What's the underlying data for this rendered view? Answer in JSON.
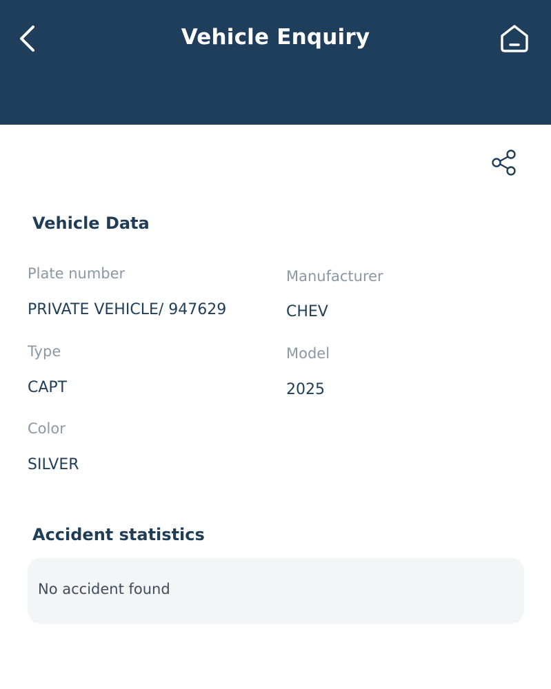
{
  "header": {
    "title": "Vehicle Enquiry",
    "back_icon": "chevron-left-icon",
    "home_icon": "home-icon",
    "background_color": "#1f3e5b"
  },
  "share_icon": "share-icon",
  "vehicle_data": {
    "title": "Vehicle Data",
    "plate_number": {
      "label": "Plate number",
      "value": "PRIVATE VEHICLE/ 947629"
    },
    "manufacturer": {
      "label": "Manufacturer",
      "value": "CHEV"
    },
    "type": {
      "label": "Type",
      "value": "CAPT"
    },
    "model": {
      "label": "Model",
      "value": "2025"
    },
    "color": {
      "label": "Color",
      "value": "SILVER"
    }
  },
  "accident_statistics": {
    "title": "Accident statistics",
    "message": "No accident found"
  }
}
